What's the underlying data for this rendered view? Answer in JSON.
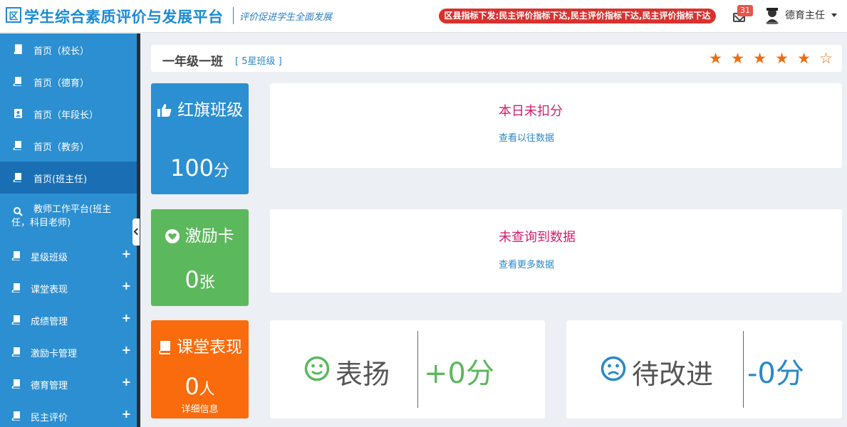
{
  "header": {
    "logo_mark": "区",
    "title": "学生综合素质评价与发展平台",
    "slogan": "评价促进学生全面发展",
    "notice": "区县指标下发:民主评价指标下达,民主评价指标下达,民主评价指标下达",
    "mail_count": "31",
    "user_name": "德育主任"
  },
  "sidebar": {
    "items": [
      {
        "label": "首页（校长）",
        "icon": "book-icon"
      },
      {
        "label": "首页（德育）",
        "icon": "book-icon"
      },
      {
        "label": "首页（年段长）",
        "icon": "contact-icon"
      },
      {
        "label": "首页（教务）",
        "icon": "book-icon"
      },
      {
        "label": "首页(班主任)",
        "icon": "book-icon",
        "active": true
      },
      {
        "label": "教师工作平台(班主任，科目老师)",
        "icon": "search-icon"
      },
      {
        "label": "星级班级",
        "icon": "book-icon",
        "expandable": true
      },
      {
        "label": "课堂表现",
        "icon": "book-icon",
        "expandable": true
      },
      {
        "label": "成绩管理",
        "icon": "book-icon",
        "expandable": true
      },
      {
        "label": "激励卡管理",
        "icon": "book-icon",
        "expandable": true
      },
      {
        "label": "德育管理",
        "icon": "book-icon",
        "expandable": true
      },
      {
        "label": "民主评价",
        "icon": "book-icon",
        "expandable": true
      }
    ],
    "plus": "+"
  },
  "class_bar": {
    "name": "一年级一班",
    "level": "[ 5星班级 ]",
    "rating": 5,
    "rating_max": 6
  },
  "tiles": {
    "red_flag": {
      "title": "红旗班级",
      "value": "100",
      "unit": "分",
      "color": "#2c8fd1"
    },
    "incentive": {
      "title": "激励卡",
      "value": "0",
      "unit": "张",
      "color": "#5cb85c"
    },
    "classroom": {
      "title": "课堂表现",
      "value": "0",
      "unit": "人",
      "detail": "详细信息",
      "color": "#f96b0c"
    }
  },
  "panels": {
    "deduction": {
      "main": "本日未扣分",
      "link": "查看以往数据"
    },
    "incentive": {
      "main": "未查询到数据",
      "link": "查看更多数据"
    },
    "praise": {
      "label": "表扬",
      "value": "+0分",
      "color": "#5cb85c"
    },
    "improve": {
      "label": "待改进",
      "value": "-0分",
      "color": "#2a88c9"
    }
  }
}
